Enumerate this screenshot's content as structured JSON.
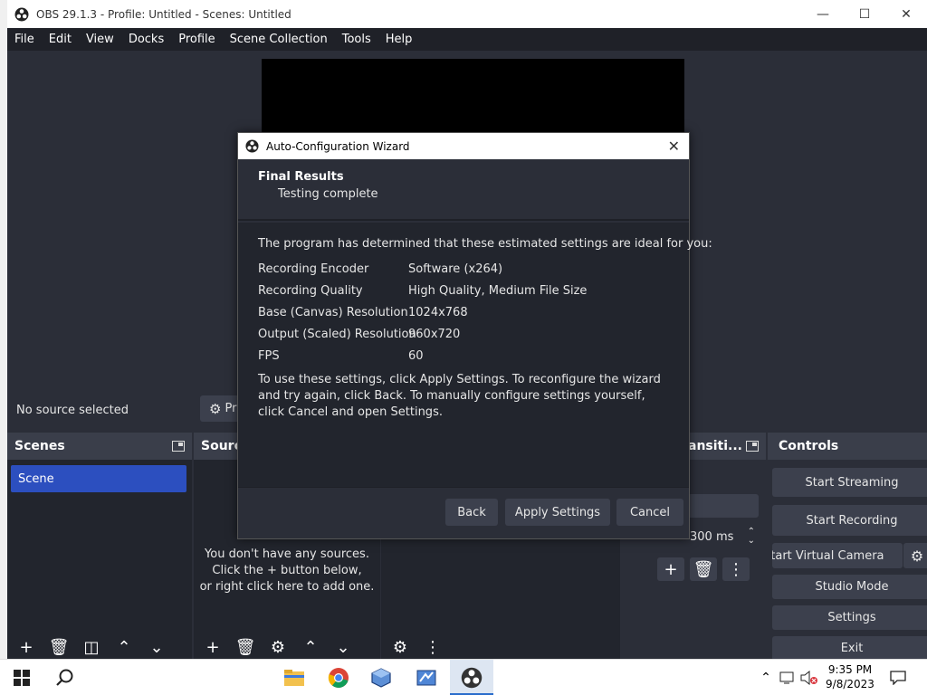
{
  "window": {
    "title": "OBS 29.1.3 - Profile: Untitled - Scenes: Untitled"
  },
  "menu": [
    "File",
    "Edit",
    "View",
    "Docks",
    "Profile",
    "Scene Collection",
    "Tools",
    "Help"
  ],
  "source_toolbar": {
    "status": "No source selected",
    "properties_label": "Pr"
  },
  "docks": {
    "scenes": {
      "title": "Scenes",
      "items": [
        "Scene"
      ]
    },
    "sources": {
      "title": "Sourc",
      "empty_line1": "You don't have any sources.",
      "empty_line2": "Click the + button below,",
      "empty_line3": "or right click here to add one."
    },
    "transitions": {
      "title": "ansiti...",
      "duration": "300 ms"
    },
    "controls": {
      "title": "Controls",
      "start_streaming": "Start Streaming",
      "start_recording": "Start Recording",
      "start_virtual_camera": "Start Virtual Camera",
      "studio_mode": "Studio Mode",
      "settings": "Settings",
      "exit": "Exit"
    }
  },
  "dialog": {
    "title": "Auto-Configuration Wizard",
    "header_title": "Final Results",
    "header_subtitle": "Testing complete",
    "intro": "The program has determined that these estimated settings are ideal for you:",
    "settings": [
      {
        "key": "Recording Encoder",
        "value": "Software (x264)"
      },
      {
        "key": "Recording Quality",
        "value": "High Quality, Medium File Size"
      },
      {
        "key": "Base (Canvas) Resolution",
        "value": "1024x768"
      },
      {
        "key": "Output (Scaled) Resolution",
        "value": "960x720"
      },
      {
        "key": "FPS",
        "value": "60"
      }
    ],
    "note": "To use these settings, click Apply Settings. To reconfigure the wizard and try again, click Back. To manually configure settings yourself, click Cancel and open Settings.",
    "buttons": {
      "back": "Back",
      "apply": "Apply Settings",
      "cancel": "Cancel"
    }
  },
  "taskbar": {
    "time": "9:35 PM",
    "date": "9/8/2023"
  },
  "colors": {
    "accent": "#2c4fbf",
    "panel": "#2b2e38",
    "dock_body": "#22252d",
    "button": "#3c404d"
  }
}
